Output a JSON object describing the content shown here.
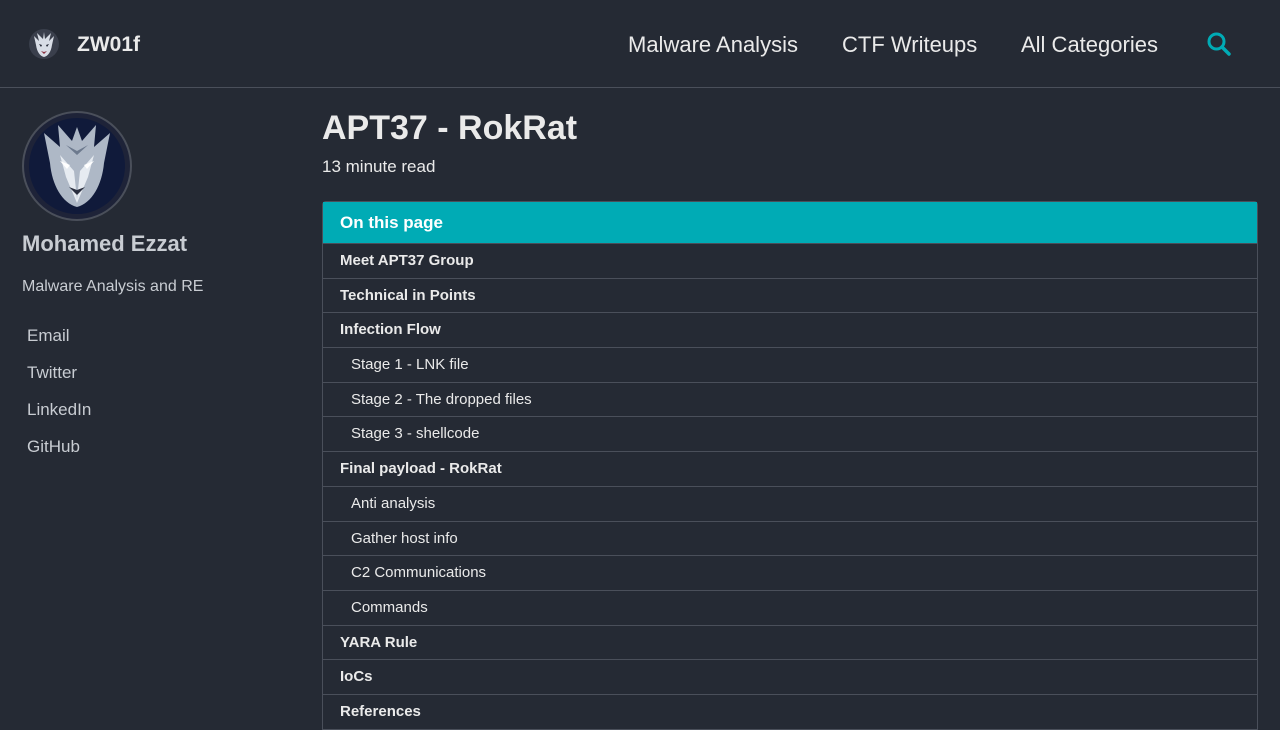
{
  "header": {
    "site_title": "ZW01f",
    "nav": [
      {
        "label": "Malware Analysis"
      },
      {
        "label": "CTF Writeups"
      },
      {
        "label": "All Categories"
      }
    ],
    "search_icon": "search-icon",
    "accent_color": "#00abb5"
  },
  "sidebar": {
    "avatar_icon": "wolf-avatar",
    "name": "Mohamed Ezzat",
    "bio": "Malware Analysis and RE",
    "links": [
      {
        "label": "Email"
      },
      {
        "label": "Twitter"
      },
      {
        "label": "LinkedIn"
      },
      {
        "label": "GitHub"
      }
    ]
  },
  "post": {
    "title": "APT37 - RokRat",
    "read_time": "13 minute read"
  },
  "toc": {
    "header": "On this page",
    "items": [
      {
        "label": "Meet APT37 Group",
        "level": 1
      },
      {
        "label": "Technical in Points",
        "level": 1
      },
      {
        "label": "Infection Flow",
        "level": 1
      },
      {
        "label": "Stage 1 - LNK file",
        "level": 2
      },
      {
        "label": "Stage 2 - The dropped files",
        "level": 2
      },
      {
        "label": "Stage 3 - shellcode",
        "level": 2
      },
      {
        "label": "Final payload - RokRat",
        "level": 1
      },
      {
        "label": "Anti analysis",
        "level": 2
      },
      {
        "label": "Gather host info",
        "level": 2
      },
      {
        "label": "C2 Communications",
        "level": 2
      },
      {
        "label": "Commands",
        "level": 2
      },
      {
        "label": "YARA Rule",
        "level": 1
      },
      {
        "label": "IoCs",
        "level": 1
      },
      {
        "label": "References",
        "level": 1
      }
    ]
  }
}
